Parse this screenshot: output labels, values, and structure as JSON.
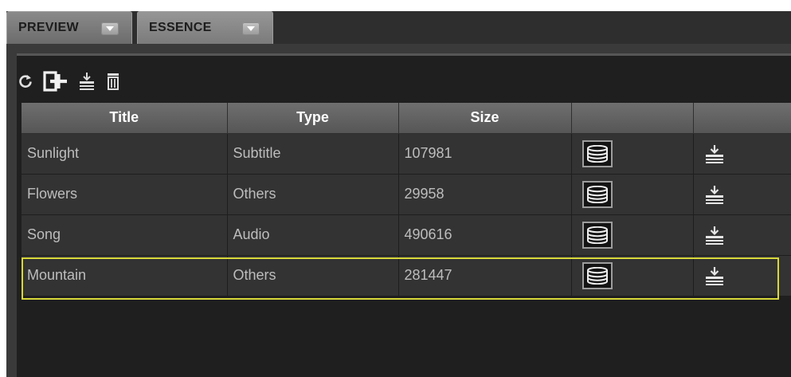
{
  "tabs": [
    {
      "label": "PREVIEW"
    },
    {
      "label": "ESSENCE"
    }
  ],
  "toolbar": {
    "icons": [
      "refresh-icon",
      "add-icon",
      "import-icon",
      "trash-icon"
    ]
  },
  "table": {
    "columns": [
      "Title",
      "Type",
      "Size",
      "",
      ""
    ],
    "rows": [
      {
        "title": "Sunlight",
        "type": "Subtitle",
        "size": "107981"
      },
      {
        "title": "Flowers",
        "type": "Others",
        "size": "29958"
      },
      {
        "title": "Song",
        "type": "Audio",
        "size": "490616"
      },
      {
        "title": "Mountain",
        "type": "Others",
        "size": "281447"
      }
    ],
    "selected_row": "Mountain"
  },
  "colors": {
    "selection": "#d8d83a",
    "row_bg": "#333333",
    "header_bg": "#666666"
  }
}
